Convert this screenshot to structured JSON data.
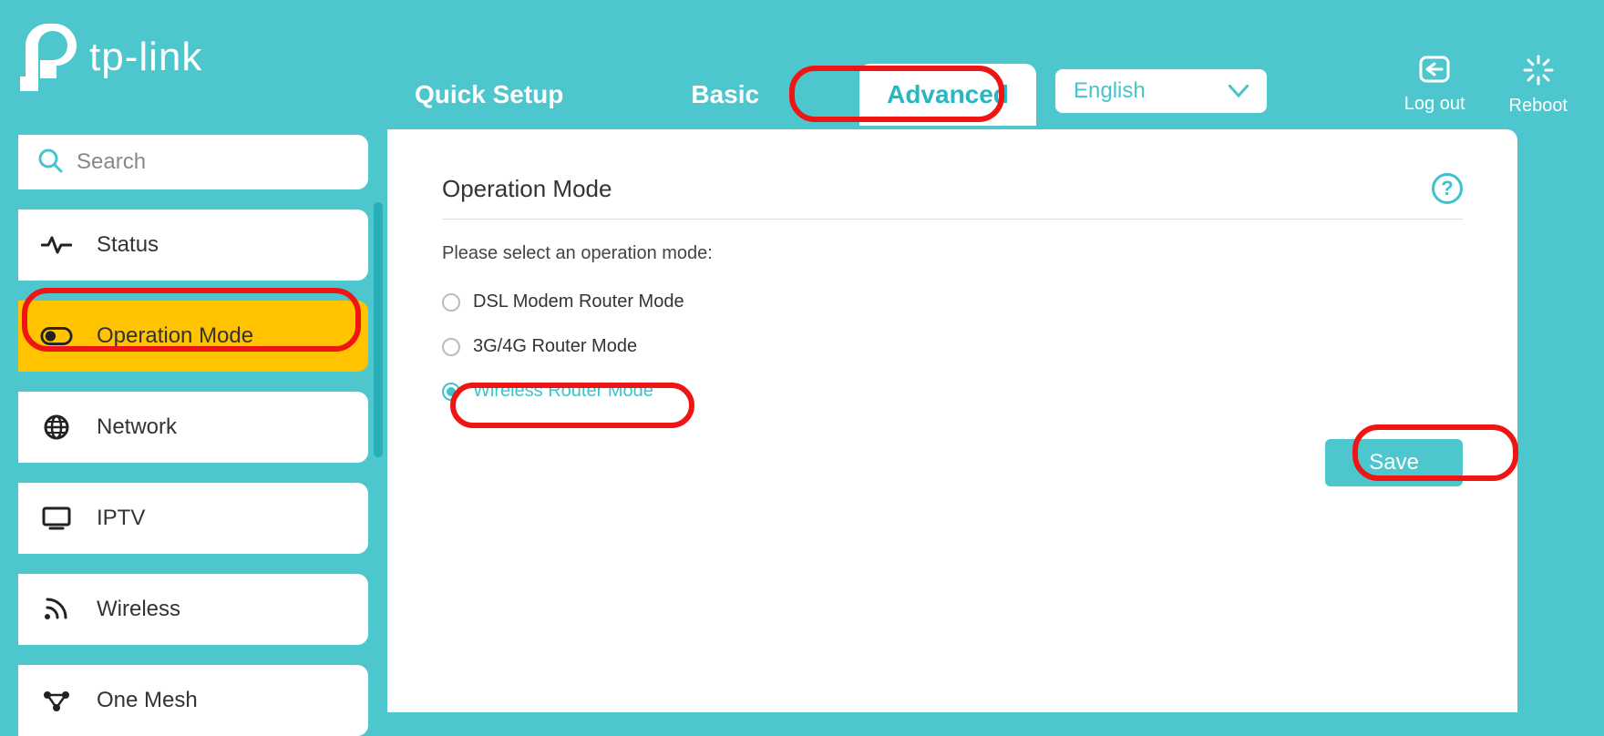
{
  "brand": "tp-link",
  "header": {
    "tabs": {
      "quick_setup": "Quick Setup",
      "basic": "Basic",
      "advanced": "Advanced"
    },
    "language": "English",
    "logout": "Log out",
    "reboot": "Reboot"
  },
  "sidebar": {
    "search_placeholder": "Search",
    "items": {
      "status": "Status",
      "operation_mode": "Operation Mode",
      "network": "Network",
      "iptv": "IPTV",
      "wireless": "Wireless",
      "one_mesh": "One Mesh"
    }
  },
  "panel": {
    "title": "Operation Mode",
    "prompt": "Please select an operation mode:",
    "options": {
      "dsl": "DSL Modem Router Mode",
      "g3g4": "3G/4G Router Mode",
      "wireless": "Wireless Router Mode"
    },
    "save": "Save"
  }
}
